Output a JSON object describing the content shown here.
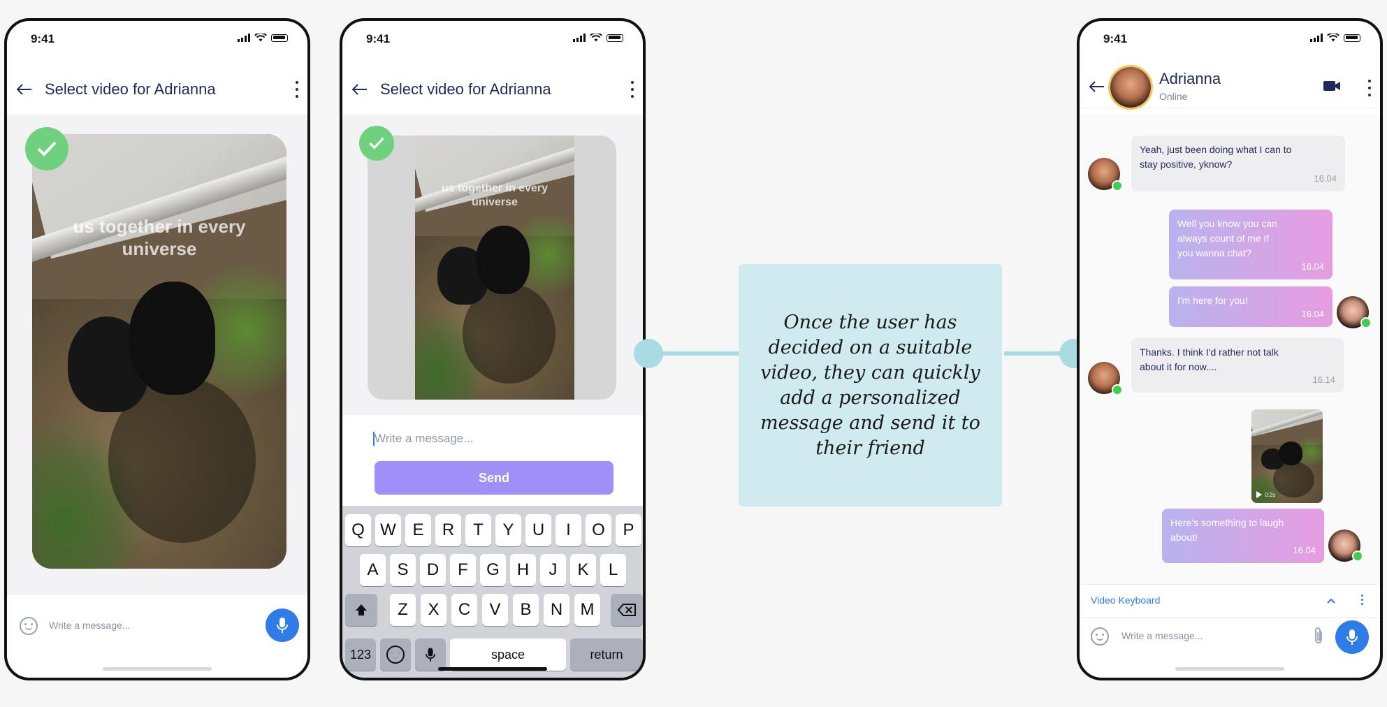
{
  "status": {
    "time": "9:41"
  },
  "screen1": {
    "title": "Select video for Adrianna",
    "video_caption": "us together in every universe",
    "composer_placeholder": "Write a message..."
  },
  "screen2": {
    "title": "Select video for Adrianna",
    "video_caption": "us together in every universe",
    "input_placeholder": "Write a message...",
    "send_label": "Send",
    "keyboard": {
      "row1": [
        "Q",
        "W",
        "E",
        "R",
        "T",
        "Y",
        "U",
        "I",
        "O",
        "P"
      ],
      "row2": [
        "A",
        "S",
        "D",
        "F",
        "G",
        "H",
        "J",
        "K",
        "L"
      ],
      "row3": [
        "Z",
        "X",
        "C",
        "V",
        "B",
        "N",
        "M"
      ],
      "numbers_label": "123",
      "space_label": "space",
      "return_label": "return"
    }
  },
  "callout": {
    "text": "Once the user has decided on a suitable video, they can quickly add a personalized message and send it to their friend"
  },
  "screen3": {
    "contact_name": "Adrianna",
    "contact_status": "Online",
    "messages": [
      {
        "text": "Yeah, just been doing what I can to stay positive, yknow?",
        "time": "16.04"
      },
      {
        "text": "Well  you know you can always count of me if  you wanna chat?",
        "time": "16.04"
      },
      {
        "text": "I'm here for you!",
        "time": "16.04"
      },
      {
        "text": "Thanks. I think I'd rather not talk about it for now....",
        "time": "16.14"
      },
      {
        "text": "Here's something to laugh about!",
        "time": "16.04"
      }
    ],
    "video_duration": "0:2s",
    "video_keyboard_label": "Video Keyboard",
    "composer_placeholder": "Write a message..."
  },
  "colors": {
    "accent": "#2f7be8",
    "send": "#a08ff7",
    "check": "#6fd17e",
    "callout": "#d0ebef"
  }
}
